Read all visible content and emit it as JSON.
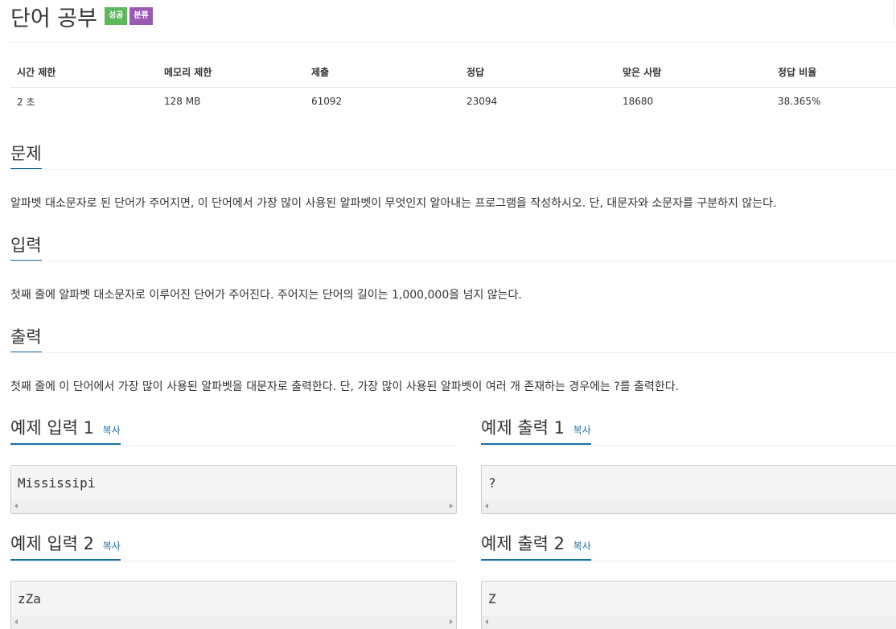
{
  "problem": {
    "title": "단어 공부",
    "badges": [
      {
        "label": "성공",
        "color": "#5cb85c"
      },
      {
        "label": "분류",
        "color": "#9b59b6"
      }
    ]
  },
  "info_table": {
    "headers": [
      "시간 제한",
      "메모리 제한",
      "제출",
      "정답",
      "맞은 사람",
      "정답 비율"
    ],
    "values": [
      "2 초",
      "128 MB",
      "61092",
      "23094",
      "18680",
      "38.365%"
    ]
  },
  "sections": {
    "description": {
      "title": "문제",
      "text": "알파벳 대소문자로 된 단어가 주어지면, 이 단어에서 가장 많이 사용된 알파벳이 무엇인지 알아내는 프로그램을 작성하시오. 단, 대문자와 소문자를 구분하지 않는다."
    },
    "input": {
      "title": "입력",
      "text": "첫째 줄에 알파벳 대소문자로 이루어진 단어가 주어진다. 주어지는 단어의 길이는 1,000,000을 넘지 않는다."
    },
    "output": {
      "title": "출력",
      "text": "첫째 줄에 이 단어에서 가장 많이 사용된 알파벳을 대문자로 출력한다. 단, 가장 많이 사용된 알파벳이 여러 개 존재하는 경우에는 ?를 출력한다."
    }
  },
  "examples": {
    "copy_label": "복사",
    "input1": {
      "title": "예제 입력 1",
      "value": "Mississipi"
    },
    "output1": {
      "title": "예제 출력 1",
      "value": "?"
    },
    "input2": {
      "title": "예제 입력 2",
      "value": "zZa"
    },
    "output2": {
      "title": "예제 출력 2",
      "value": "Z"
    }
  },
  "colors": {
    "accent": "#1a6ea8",
    "badge_success": "#5cb85c",
    "badge_category": "#9b59b6"
  }
}
